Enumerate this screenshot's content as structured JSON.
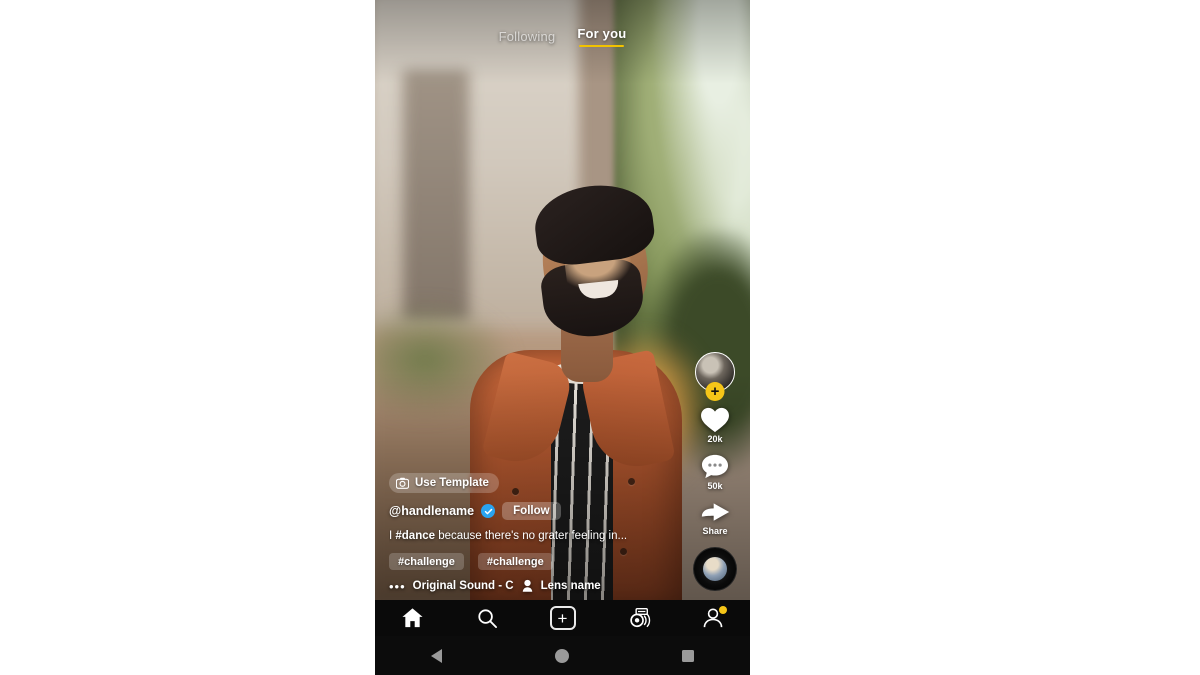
{
  "app": {
    "name": "Short Video App Feed",
    "platform": "Android"
  },
  "top_tabs": {
    "following_label": "Following",
    "for_you_label": "For you",
    "active": "For you",
    "active_underline_color": "#f2c200"
  },
  "action_rail": {
    "follow_badge": "+",
    "like": {
      "icon": "heart-icon",
      "count": "20k"
    },
    "comment": {
      "icon": "comment-icon",
      "count": "50k"
    },
    "share": {
      "icon": "share-icon",
      "label": "Share"
    },
    "sound_disc": "music-disc-icon"
  },
  "caption": {
    "template_button": "Use Template",
    "template_icon": "camera-icon",
    "handle": "@handlename",
    "verified_icon": "verified-check-icon",
    "follow_button": "Follow",
    "text_prefix": "I ",
    "text_tag": "#dance",
    "text_rest": " because there's no grater feeling in...",
    "hashtags": [
      "#challenge",
      "#challenge"
    ],
    "more_dots": "•••",
    "sound_text": "Original Sound - C",
    "lens_text": "Lens name",
    "lens_icon": "lens-icon"
  },
  "bottom_nav": {
    "items": [
      {
        "name": "home",
        "icon": "home-icon",
        "label": ""
      },
      {
        "name": "discover",
        "icon": "search-icon",
        "label": ""
      },
      {
        "name": "create",
        "icon": "plus-icon",
        "label": ""
      },
      {
        "name": "lens",
        "icon": "camera-lens-icon",
        "label": ""
      },
      {
        "name": "profile",
        "icon": "person-icon",
        "label": "",
        "badge": true
      }
    ],
    "badge_color": "#f5c518"
  },
  "annotation": {
    "type": "hand-drawn-ellipse",
    "color": "#ffffff",
    "target": "create-button"
  },
  "system_bar": {
    "back": "back-triangle-icon",
    "home": "home-circle-icon",
    "recents": "recents-square-icon"
  },
  "colors": {
    "page_background": "#ffffff",
    "nav_background": "#0a0a0a",
    "accent_yellow": "#f5c518",
    "verified_blue": "#2aa3f0"
  }
}
